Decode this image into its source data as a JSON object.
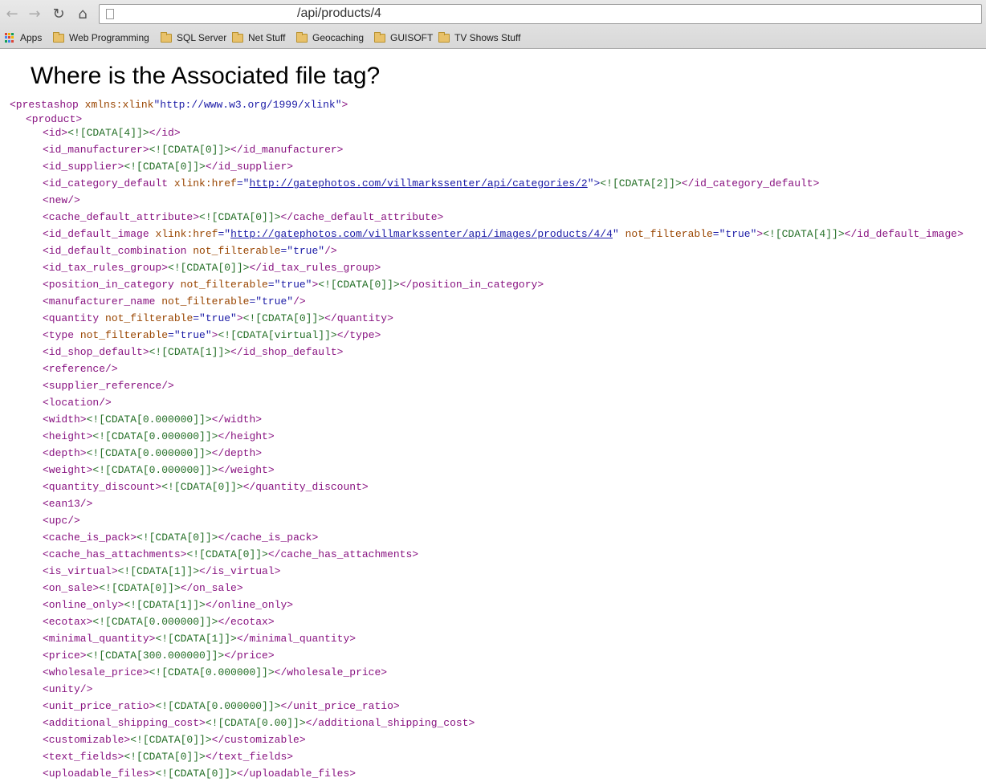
{
  "browser": {
    "url_path": "/api/products/4",
    "bookmarks": [
      {
        "label": "Apps",
        "icon": "apps-grid-icon"
      },
      {
        "label": "Web Programming",
        "icon": "folder-icon"
      },
      {
        "label": "SQL Server",
        "icon": "folder-icon"
      },
      {
        "label": "Net Stuff",
        "icon": "folder-icon"
      },
      {
        "label": "Geocaching",
        "icon": "folder-icon"
      },
      {
        "label": "GUISOFT",
        "icon": "folder-icon"
      },
      {
        "label": "TV Shows Stuff",
        "icon": "folder-icon"
      }
    ]
  },
  "annotation": "Where is the Associated file tag?",
  "xml": {
    "root_open": "<prestashop",
    "root_attr": "xmlns:xlink",
    "root_val": "\"http://www.w3.org/1999/xlink\"",
    "root_close": ">",
    "product_open": "<product>",
    "lines": [
      {
        "pre": "<id>",
        "cdata": "<![CDATA[4]]>",
        "post": "</id>"
      },
      {
        "pre": "<id_manufacturer>",
        "cdata": "<![CDATA[0]]>",
        "post": "</id_manufacturer>"
      },
      {
        "pre": "<id_supplier>",
        "cdata": "<![CDATA[0]]>",
        "post": "</id_supplier>"
      },
      {
        "pre": "<id_category_default",
        "attr": "xlink:href",
        "eq": "=\"",
        "link": "http://gatephotos.com/villmarkssenter/api/categories/2",
        "eq2": "\">",
        "cdata": "<![CDATA[2]]>",
        "post": "</id_category_default>"
      },
      {
        "pre": "<new/>"
      },
      {
        "pre": "<cache_default_attribute>",
        "cdata": "<![CDATA[0]]>",
        "post": "</cache_default_attribute>"
      },
      {
        "pre": "<id_default_image",
        "attr": "xlink:href",
        "eq": "=\"",
        "link": "http://gatephotos.com/villmarkssenter/api/images/products/4/4",
        "eq2": "\"",
        "attr2": "not_filterable",
        "val2": "=\"true\"",
        "gt": ">",
        "cdata": "<![CDATA[4]]>",
        "post": "</id_default_image>"
      },
      {
        "pre": "<id_default_combination",
        "attr2": "not_filterable",
        "val2": "=\"true\"",
        "gt": "/>"
      },
      {
        "pre": "<id_tax_rules_group>",
        "cdata": "<![CDATA[0]]>",
        "post": "</id_tax_rules_group>"
      },
      {
        "pre": "<position_in_category",
        "attr2": "not_filterable",
        "val2": "=\"true\"",
        "gt": ">",
        "cdata": "<![CDATA[0]]>",
        "post": "</position_in_category>"
      },
      {
        "pre": "<manufacturer_name",
        "attr2": "not_filterable",
        "val2": "=\"true\"",
        "gt": "/>"
      },
      {
        "pre": "<quantity",
        "attr2": "not_filterable",
        "val2": "=\"true\"",
        "gt": ">",
        "cdata": "<![CDATA[0]]>",
        "post": "</quantity>"
      },
      {
        "pre": "<type",
        "attr2": "not_filterable",
        "val2": "=\"true\"",
        "gt": ">",
        "cdata": "<![CDATA[virtual]]>",
        "post": "</type>"
      },
      {
        "pre": "<id_shop_default>",
        "cdata": "<![CDATA[1]]>",
        "post": "</id_shop_default>"
      },
      {
        "pre": "<reference/>"
      },
      {
        "pre": "<supplier_reference/>"
      },
      {
        "pre": "<location/>"
      },
      {
        "pre": "<width>",
        "cdata": "<![CDATA[0.000000]]>",
        "post": "</width>"
      },
      {
        "pre": "<height>",
        "cdata": "<![CDATA[0.000000]]>",
        "post": "</height>"
      },
      {
        "pre": "<depth>",
        "cdata": "<![CDATA[0.000000]]>",
        "post": "</depth>"
      },
      {
        "pre": "<weight>",
        "cdata": "<![CDATA[0.000000]]>",
        "post": "</weight>"
      },
      {
        "pre": "<quantity_discount>",
        "cdata": "<![CDATA[0]]>",
        "post": "</quantity_discount>"
      },
      {
        "pre": "<ean13/>"
      },
      {
        "pre": "<upc/>"
      },
      {
        "pre": "<cache_is_pack>",
        "cdata": "<![CDATA[0]]>",
        "post": "</cache_is_pack>"
      },
      {
        "pre": "<cache_has_attachments>",
        "cdata": "<![CDATA[0]]>",
        "post": "</cache_has_attachments>"
      },
      {
        "pre": "<is_virtual>",
        "cdata": "<![CDATA[1]]>",
        "post": "</is_virtual>"
      },
      {
        "pre": "<on_sale>",
        "cdata": "<![CDATA[0]]>",
        "post": "</on_sale>"
      },
      {
        "pre": "<online_only>",
        "cdata": "<![CDATA[1]]>",
        "post": "</online_only>"
      },
      {
        "pre": "<ecotax>",
        "cdata": "<![CDATA[0.000000]]>",
        "post": "</ecotax>"
      },
      {
        "pre": "<minimal_quantity>",
        "cdata": "<![CDATA[1]]>",
        "post": "</minimal_quantity>"
      },
      {
        "pre": "<price>",
        "cdata": "<![CDATA[300.000000]]>",
        "post": "</price>"
      },
      {
        "pre": "<wholesale_price>",
        "cdata": "<![CDATA[0.000000]]>",
        "post": "</wholesale_price>"
      },
      {
        "pre": "<unity/>"
      },
      {
        "pre": "<unit_price_ratio>",
        "cdata": "<![CDATA[0.000000]]>",
        "post": "</unit_price_ratio>"
      },
      {
        "pre": "<additional_shipping_cost>",
        "cdata": "<![CDATA[0.00]]>",
        "post": "</additional_shipping_cost>"
      },
      {
        "pre": "<customizable>",
        "cdata": "<![CDATA[0]]>",
        "post": "</customizable>"
      },
      {
        "pre": "<text_fields>",
        "cdata": "<![CDATA[0]]>",
        "post": "</text_fields>"
      },
      {
        "pre": "<uploadable_files>",
        "cdata": "<![CDATA[0]]>",
        "post": "</uploadable_files>"
      }
    ]
  }
}
